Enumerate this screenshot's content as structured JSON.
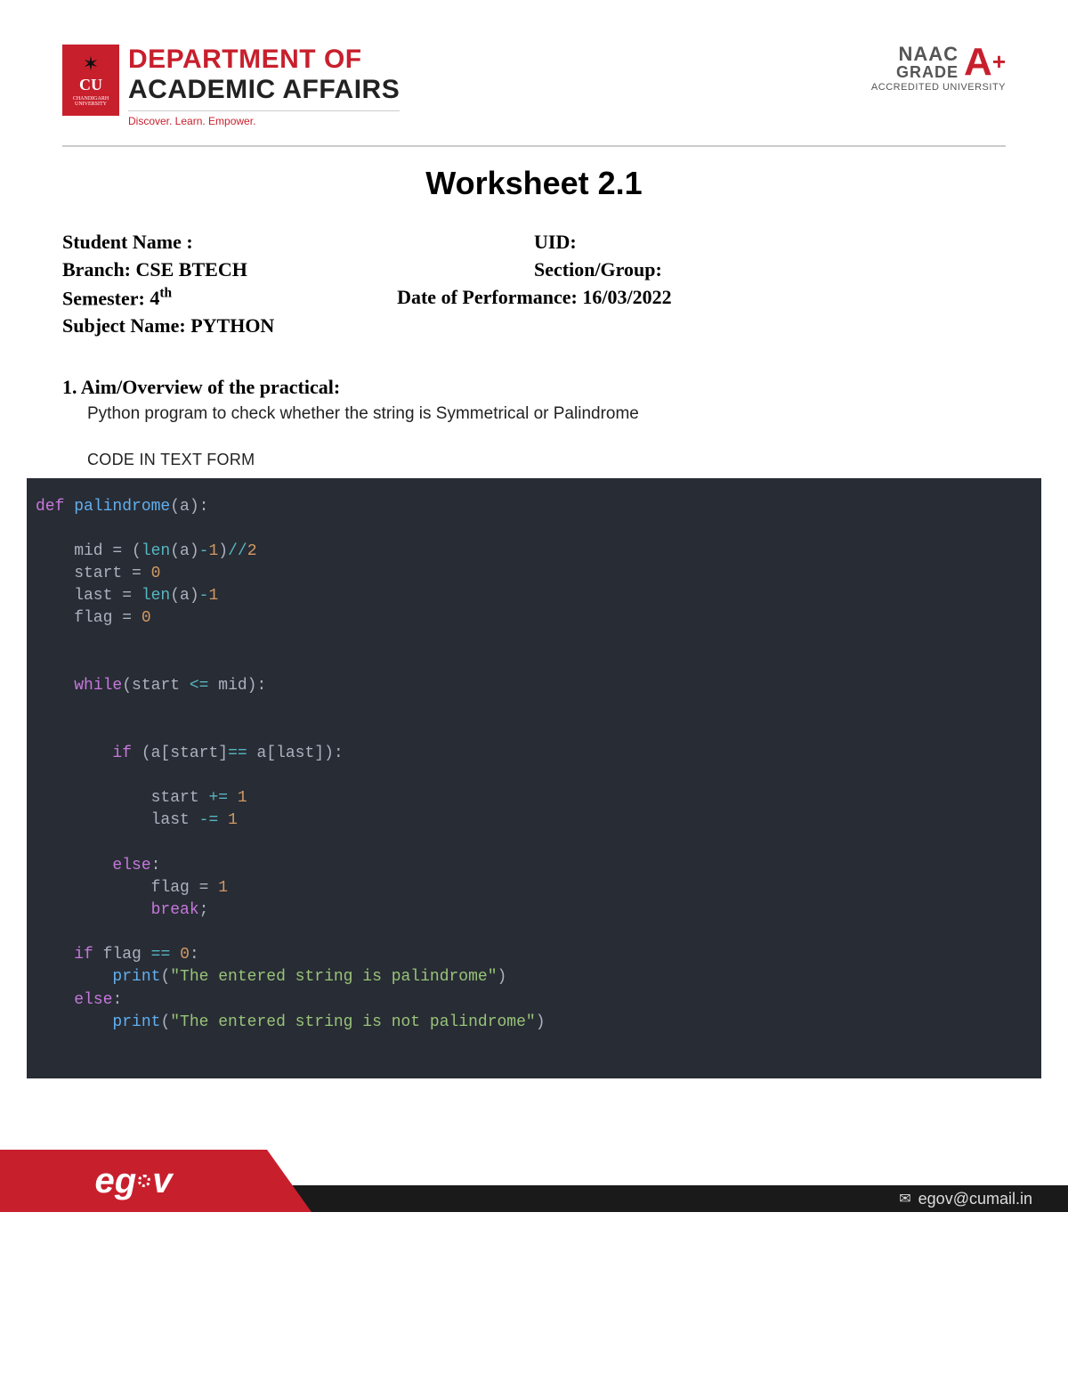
{
  "header": {
    "badge_cu": "CU",
    "badge_sub": "CHANDIGARH UNIVERSITY",
    "dept_line1": "DEPARTMENT OF",
    "dept_line2": "ACADEMIC AFFAIRS",
    "tagline": "Discover. Learn. Empower.",
    "naac_line1": "NAAC",
    "naac_line2": "GRADE",
    "naac_grade": "A",
    "naac_plus": "+",
    "naac_acc": "ACCREDITED UNIVERSITY"
  },
  "title": "Worksheet 2.1",
  "info": {
    "student_label": "Student Name :",
    "uid_label": "UID:",
    "branch_label": "Branch:",
    "branch_value": "CSE BTECH",
    "section_label": "Section/Group:",
    "semester_label": "Semester:",
    "semester_value_main": "4",
    "semester_value_sup": "th",
    "dop_label": "Date of Performance:",
    "dop_value": "16/03/2022",
    "subject_label": "Subject Name:",
    "subject_value": "PYTHON"
  },
  "section1": {
    "heading": "1. Aim/Overview of the practical:",
    "text": "Python program to check whether the string is Symmetrical or Palindrome",
    "code_label": "CODE IN TEXT FORM"
  },
  "code": {
    "l1_def": "def",
    "l1_fn": "palindrome",
    "l1_rest": "(a):",
    "l2_a": "    mid = (",
    "l2_len": "len",
    "l2_b": "(a)",
    "l2_m": "-",
    "l2_n1": "1",
    "l2_c": ")",
    "l2_fd": "//",
    "l2_n2": "2",
    "l3_a": "    start = ",
    "l3_n": "0",
    "l4_a": "    last = ",
    "l4_len": "len",
    "l4_b": "(a)",
    "l4_m": "-",
    "l4_n": "1",
    "l5_a": "    flag = ",
    "l5_n": "0",
    "l6_w": "while",
    "l6_a": "(start ",
    "l6_op": "<=",
    "l6_b": " mid):",
    "l7_if": "if",
    "l7_a": " (a[start]",
    "l7_eq": "==",
    "l7_b": " a[last]):",
    "l8_a": "            start ",
    "l8_op": "+=",
    "l8_sp": " ",
    "l8_n": "1",
    "l9_a": "            last ",
    "l9_op": "-=",
    "l9_sp": " ",
    "l9_n": "1",
    "l10_else": "else",
    "l10_c": ":",
    "l11_a": "            flag = ",
    "l11_n": "1",
    "l12_break": "break",
    "l12_sc": ";",
    "l13_if": "if",
    "l13_a": " flag ",
    "l13_eq": "==",
    "l13_sp": " ",
    "l13_n": "0",
    "l13_c": ":",
    "l14_print": "print",
    "l14_p1": "(",
    "l14_s": "\"The entered string is palindrome\"",
    "l14_p2": ")",
    "l15_else": "else",
    "l15_c": ":",
    "l16_print": "print",
    "l16_p1": "(",
    "l16_s": "\"The entered string is not palindrome\"",
    "l16_p2": ")"
  },
  "footer": {
    "egov": "eg  v",
    "email": "egov@cumail.in"
  }
}
